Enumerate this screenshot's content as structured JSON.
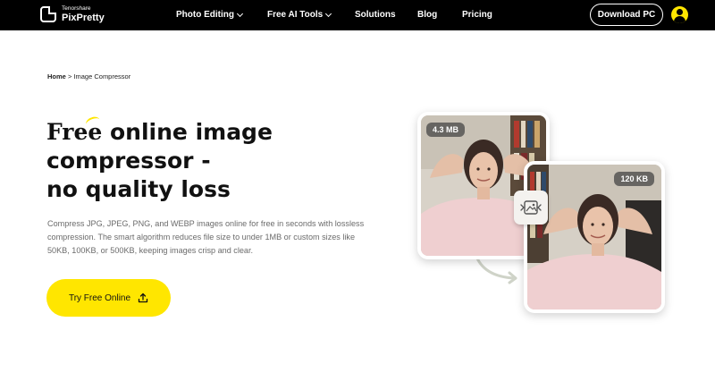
{
  "header": {
    "logo_sub": "Tenorshare",
    "logo_name": "PixPretty",
    "nav": [
      {
        "label": "Photo Editing",
        "dropdown": true
      },
      {
        "label": "Free AI Tools",
        "dropdown": true
      },
      {
        "label": "Solutions",
        "dropdown": false
      },
      {
        "label": "Blog",
        "dropdown": false
      },
      {
        "label": "Pricing",
        "dropdown": false
      }
    ],
    "download_label": "Download PC"
  },
  "breadcrumb": {
    "home": "Home",
    "separator": ">",
    "current": "Image Compressor"
  },
  "hero": {
    "title_highlight": "Free",
    "title_line1_rest": " online image",
    "title_line2": "compressor -",
    "title_line3": "no quality loss",
    "description": "Compress JPG, JPEG, PNG, and WEBP images online for free in seconds with lossless compression. The smart algorithm reduces file size to under 1MB or custom sizes like 50KB, 100KB, or 500KB, keeping images crisp and clear.",
    "cta_label": "Try Free Online"
  },
  "images": {
    "before_size": "4.3 MB",
    "after_size": "120 KB"
  },
  "colors": {
    "accent": "#ffe600",
    "nav_bg": "#000000",
    "text": "#111111",
    "muted": "#6b6b6b"
  }
}
